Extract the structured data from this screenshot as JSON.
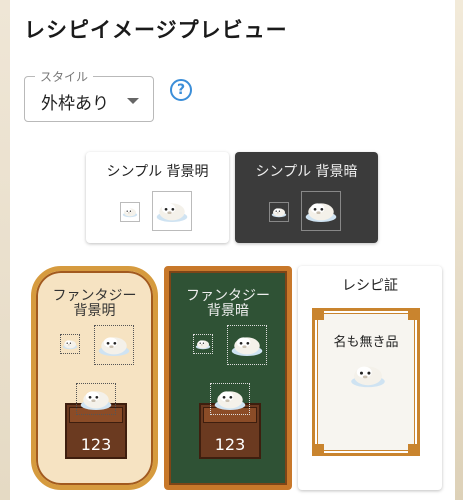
{
  "header": {
    "title": "レシピイメージプレビュー"
  },
  "style_select": {
    "legend": "スタイル",
    "value": "外枠あり"
  },
  "help": {
    "symbol": "?"
  },
  "previews": {
    "simple_light": {
      "label": "シンプル 背景明"
    },
    "simple_dark": {
      "label": "シンプル 背景暗"
    },
    "fantasy_light": {
      "label_line1": "ファンタジー",
      "label_line2": "背景明",
      "count": "123"
    },
    "fantasy_dark": {
      "label_line1": "ファンタジー",
      "label_line2": "背景暗",
      "count": "123"
    },
    "certificate": {
      "label": "レシピ証",
      "item_name": "名も無き品"
    }
  },
  "colors": {
    "help_accent": "#3b8ed8",
    "dark_bg": "#3b3b3b",
    "fantasy_frame": "#d69b3f",
    "fantasy_green": "#2f5235",
    "cert_frame": "#c9842e"
  }
}
